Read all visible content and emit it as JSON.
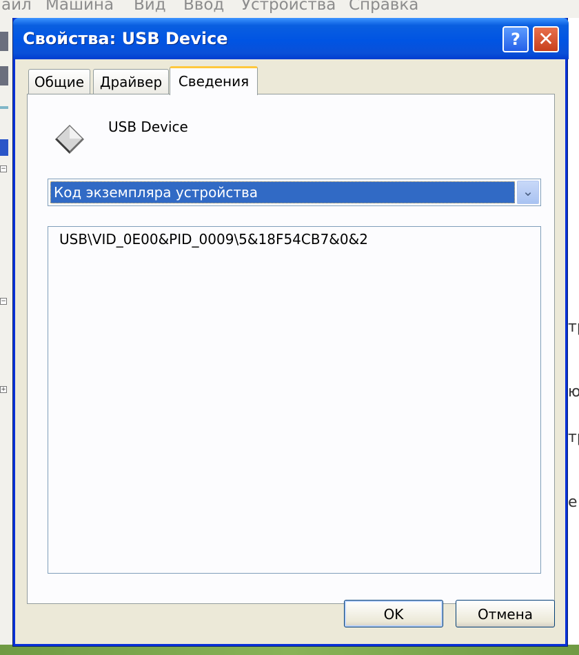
{
  "background_app": {
    "menu": [
      "айл",
      "Машина",
      "Вид",
      "Ввод",
      "Устройства",
      "Справка"
    ],
    "right_edge_fragments": [
      "тр",
      "ю",
      "тр",
      "е"
    ]
  },
  "dialog": {
    "title": "Свойства: USB Device",
    "help_label": "?",
    "close_label": "✕",
    "tabs": [
      {
        "label": "Общие",
        "active": false
      },
      {
        "label": "Драйвер",
        "active": false
      },
      {
        "label": "Сведения",
        "active": true
      }
    ],
    "device": {
      "icon": "usb-device-icon",
      "name": "USB Device"
    },
    "property_select": {
      "selected": "Код экземпляра устройства",
      "arrow": "⌄"
    },
    "values": [
      "USB\\VID_0E00&PID_0009\\5&18F54CB7&0&2"
    ],
    "buttons": {
      "ok": "OK",
      "cancel": "Отмена"
    }
  },
  "colors": {
    "titlebar": "#0054e3",
    "selection": "#316ac5",
    "dialog_bg": "#ece9d8",
    "active_tab_accent": "#ffc83c"
  }
}
